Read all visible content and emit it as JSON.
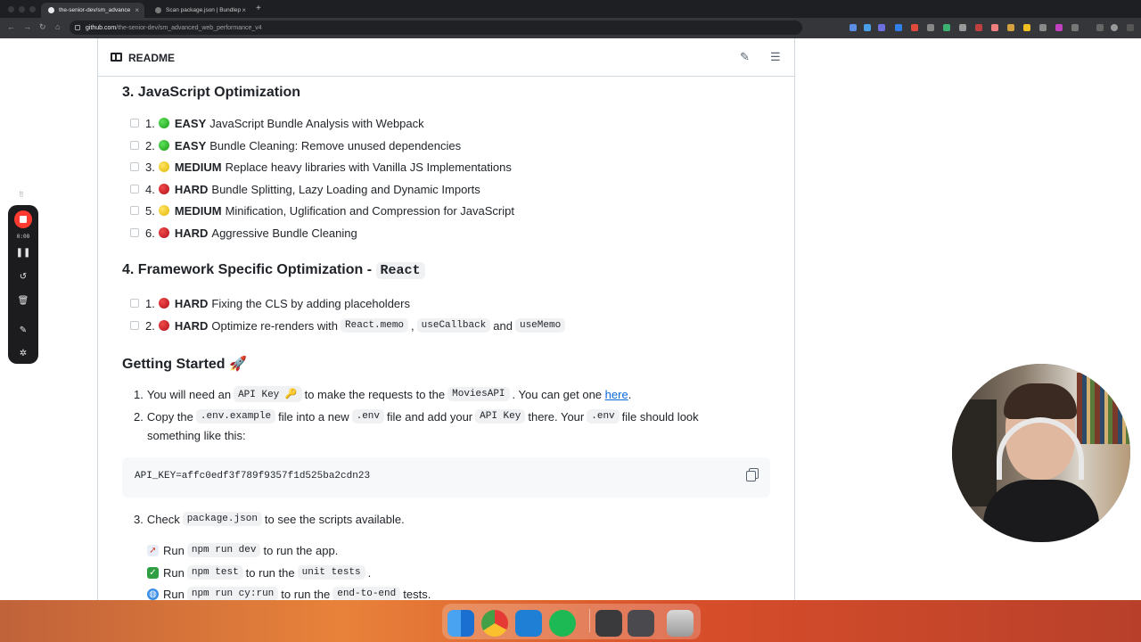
{
  "browser": {
    "tabs": [
      {
        "title": "the-senior-dev/sm_advance",
        "active": true
      },
      {
        "title": "Scan package.json | Bundlep",
        "active": false
      }
    ],
    "url": {
      "host": "github.com",
      "path": "/the-senior-dev/sm_advanced_web_performance_v4"
    }
  },
  "readme": {
    "title": "README",
    "sections": [
      {
        "heading": "3. JavaScript Optimization",
        "items": [
          {
            "num": "1.",
            "level": "EASY",
            "text": "JavaScript Bundle Analysis with Webpack"
          },
          {
            "num": "2.",
            "level": "EASY",
            "text": "Bundle Cleaning: Remove unused dependencies"
          },
          {
            "num": "3.",
            "level": "MEDIUM",
            "text": "Replace heavy libraries with Vanilla JS Implementations"
          },
          {
            "num": "4.",
            "level": "HARD",
            "text": "Bundle Splitting, Lazy Loading and Dynamic Imports"
          },
          {
            "num": "5.",
            "level": "MEDIUM",
            "text": "Minification, Uglification and Compression for JavaScript"
          },
          {
            "num": "6.",
            "level": "HARD",
            "text": "Aggressive Bundle Cleaning"
          }
        ]
      },
      {
        "heading": "4. Framework Specific Optimization - ",
        "heading_code": "React",
        "items": [
          {
            "num": "1.",
            "level": "HARD",
            "text": "Fixing the CLS by adding placeholders"
          },
          {
            "num": "2.",
            "level": "HARD",
            "text": "Optimize re-renders with",
            "code1": "React.memo",
            "sep1": ",",
            "code2": "useCallback",
            "sep2": "and",
            "code3": "useMemo"
          }
        ]
      }
    ],
    "getting_started": {
      "heading": "Getting Started 🚀",
      "step1": {
        "num": "1.",
        "a": "You will need an",
        "code1": "API Key 🔑",
        "b": "to make the requests to the",
        "code2": "MoviesAPI",
        "c": ". You can get one",
        "link": "here",
        "d": "."
      },
      "step2": {
        "num": "2.",
        "a": "Copy the",
        "code1": ".env.example",
        "b": "file into a new",
        "code2": ".env",
        "c": "file and add your",
        "code3": "API Key",
        "d": "there. Your",
        "code4": ".env",
        "e": "file should look",
        "f": "something like this:"
      },
      "code_block": "API_KEY=affc0edf3f789f9357f1d525ba2cdn23",
      "step3": {
        "num": "3.",
        "a": "Check",
        "code1": "package.json",
        "b": "to see the scripts available."
      },
      "bullets": [
        {
          "icon": "rocket-icon",
          "a": "Run",
          "code1": "npm run dev",
          "b": "to run the app.",
          "code2": "",
          "c": ""
        },
        {
          "icon": "check-icon",
          "a": "Run",
          "code1": "npm test",
          "b": "to run the",
          "code2": "unit tests",
          "c": "."
        },
        {
          "icon": "globe-icon",
          "a": "Run",
          "code1": "npm run cy:run",
          "b": "to run the",
          "code2": "end-to-end",
          "c": "tests."
        }
      ]
    }
  },
  "recorder": {
    "time": "0:00"
  },
  "colors": {
    "link": "#0969da",
    "easy": "#2fb52c",
    "medium": "#f2c200",
    "hard": "#d0121f",
    "record": "#ff3b30"
  }
}
